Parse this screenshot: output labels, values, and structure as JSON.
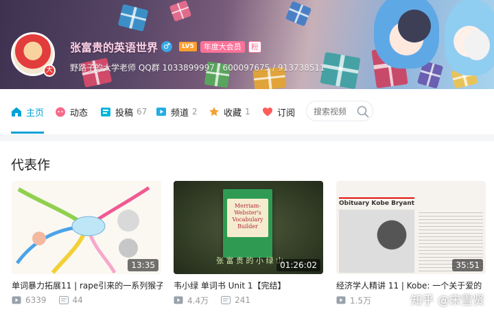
{
  "profile": {
    "name": "张富贵的英语世界",
    "gender_symbol": "♂",
    "level": "LV5",
    "vip_label": "年度大会员",
    "fan_badge": "粉",
    "avatar_badge": "大",
    "sign": "野路子的大学老师 QQ群 1033899997 / 600097675 / 913738511"
  },
  "nav": {
    "items": [
      {
        "label": "主页",
        "count": "",
        "icon": "home-icon"
      },
      {
        "label": "动态",
        "count": "",
        "icon": "dynamic-icon"
      },
      {
        "label": "投稿",
        "count": "67",
        "icon": "upload-icon"
      },
      {
        "label": "频道",
        "count": "2",
        "icon": "channel-icon"
      },
      {
        "label": "收藏",
        "count": "1",
        "icon": "star-icon"
      },
      {
        "label": "订阅",
        "count": "",
        "icon": "heart-icon"
      }
    ],
    "search_placeholder": "搜索视频"
  },
  "section_title": "代表作",
  "videos": [
    {
      "title": "单词暴力拓展11 | rape引来的一系列猴子",
      "duration": "13:35",
      "views": "6339",
      "danmaku": "44"
    },
    {
      "title": "韦小绿 单词书 Unit 1【完结】",
      "duration": "01:26:02",
      "views": "4.4万",
      "danmaku": "241",
      "book_text": "Merriam-Webster's Vocabulary Builder",
      "overlay_text": "张 富 贵 的 小 绿 山"
    },
    {
      "title": "经济学人精讲 11 | Kobe: 一个关于爱的",
      "duration": "35:51",
      "views": "1.5万",
      "danmaku": "",
      "obit_header": "Obituary Kobe Bryant"
    }
  ],
  "watermark": "知乎 @宋雪贤",
  "colors": {
    "accent": "#00a1d6",
    "pink": "#fb7299",
    "level": "#ff9f2e"
  }
}
